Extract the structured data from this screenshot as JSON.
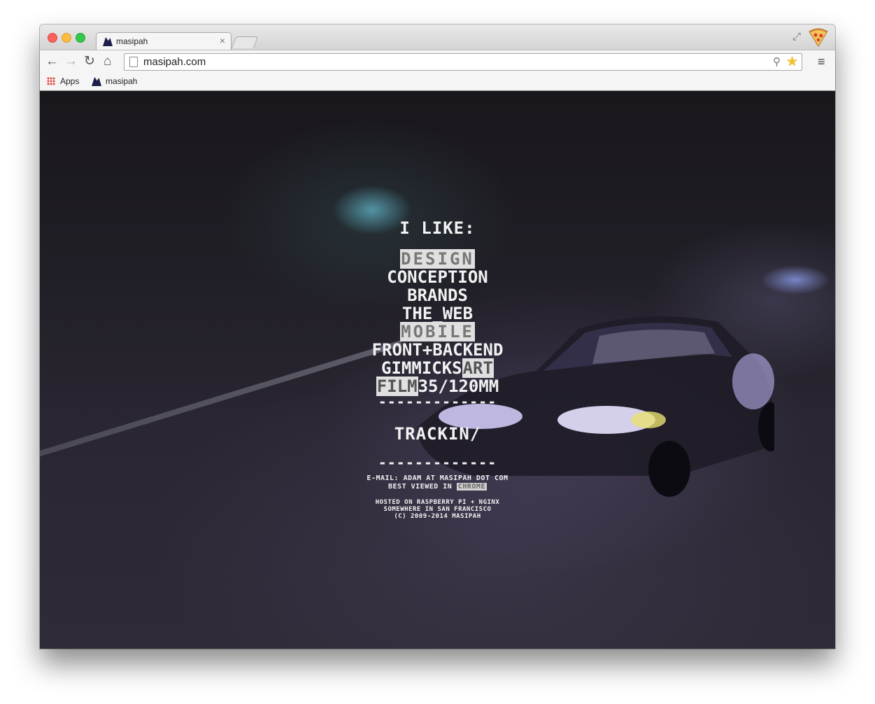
{
  "browser": {
    "tab": {
      "title": "masipah",
      "close": "×"
    },
    "toolbar": {
      "url": "masipah.com"
    },
    "bookmarks": [
      {
        "label": "Apps"
      },
      {
        "label": "masipah"
      }
    ],
    "icons": {
      "back": "←",
      "forward": "→",
      "reload": "↻",
      "home": "⌂",
      "search": "⚲",
      "star": "★",
      "menu": "≡",
      "fullscreen": "⤢"
    }
  },
  "page": {
    "heading": "I LIKE:",
    "items": [
      {
        "text": "DESIGN",
        "highlight": true
      },
      {
        "text": "CONCEPTION",
        "highlight": false
      },
      {
        "text": "BRANDS",
        "highlight": false
      },
      {
        "text": "THE_WEB",
        "highlight": false
      },
      {
        "text": "MOBILE",
        "highlight": true
      },
      {
        "text": "FRONT+BACKEND",
        "highlight": false
      }
    ],
    "gimmicks": {
      "plain": "GIMMICKS",
      "hl": "ART"
    },
    "film": {
      "hl": "FILM",
      "plain": "35/120MM"
    },
    "dashes": "-------------",
    "trackin": "TRACKIN/",
    "email_line": "E-MAIL: ADAM AT MASIPAH DOT COM",
    "best_viewed": "BEST VIEWED IN",
    "best_viewed_browser": "CHROME",
    "hosted": "HOSTED ON RASPBERRY PI + NGINX",
    "location": "SOMEWHERE IN SAN FRANCISCO",
    "copyright": "(C) 2009-2014 MASIPAH"
  }
}
